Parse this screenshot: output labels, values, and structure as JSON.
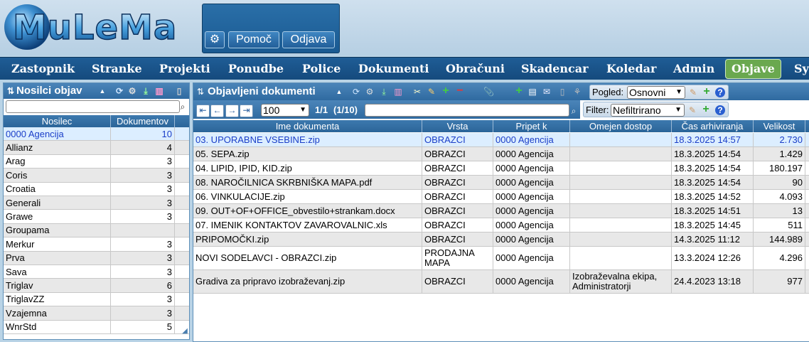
{
  "app": {
    "logo_text": "MuLeMa"
  },
  "toolbar": {
    "settings_icon": "gear-icon",
    "help_label": "Pomoč",
    "logout_label": "Odjava"
  },
  "nav": {
    "items": [
      "Zastopnik",
      "Stranke",
      "Projekti",
      "Ponudbe",
      "Police",
      "Dokumenti",
      "Obračuni",
      "Skadencar",
      "Koledar",
      "Admin",
      "Objave",
      "Sy"
    ],
    "active": "Objave"
  },
  "left_panel": {
    "title": "Nosilci objav",
    "search_placeholder": "",
    "columns": [
      "Nosilec",
      "Dokumentov"
    ],
    "rows": [
      {
        "name": "0000 Agencija",
        "count": "10"
      },
      {
        "name": "Allianz",
        "count": "4"
      },
      {
        "name": "Arag",
        "count": "3"
      },
      {
        "name": "Coris",
        "count": "3"
      },
      {
        "name": "Croatia",
        "count": "3"
      },
      {
        "name": "Generali",
        "count": "3"
      },
      {
        "name": "Grawe",
        "count": "3"
      },
      {
        "name": "Groupama",
        "count": ""
      },
      {
        "name": "Merkur",
        "count": "3"
      },
      {
        "name": "Prva",
        "count": "3"
      },
      {
        "name": "Sava",
        "count": "3"
      },
      {
        "name": "Triglav",
        "count": "6"
      },
      {
        "name": "TriglavZZ",
        "count": "3"
      },
      {
        "name": "Vzajemna",
        "count": "3"
      },
      {
        "name": "WnrStd",
        "count": "5"
      }
    ]
  },
  "main_panel": {
    "title": "Objavljeni dokumenti",
    "view_label": "Pogled:",
    "view_value": "Osnovni",
    "filter_label": "Filter:",
    "filter_value": "Nefiltrirano",
    "page_size": "100",
    "page_info": "1/1",
    "count_info": "(1/10)",
    "search_placeholder": "",
    "columns": [
      "Ime dokumenta",
      "Vrsta",
      "Pripet k",
      "Omejen dostop",
      "Čas arhiviranja",
      "Velikost"
    ],
    "rows": [
      {
        "name": "03. UPORABNE VSEBINE.zip",
        "type": "OBRAZCI",
        "attached": "0000 Agencija",
        "restricted": "",
        "time": "18.3.2025 14:57",
        "size": "2.730"
      },
      {
        "name": "05. SEPA.zip",
        "type": "OBRAZCI",
        "attached": "0000 Agencija",
        "restricted": "",
        "time": "18.3.2025 14:54",
        "size": "1.429"
      },
      {
        "name": "04. LIPID, IPID, KID.zip",
        "type": "OBRAZCI",
        "attached": "0000 Agencija",
        "restricted": "",
        "time": "18.3.2025 14:54",
        "size": "180.197"
      },
      {
        "name": "08. NAROČILNICA SKRBNIŠKA MAPA.pdf",
        "type": "OBRAZCI",
        "attached": "0000 Agencija",
        "restricted": "",
        "time": "18.3.2025 14:54",
        "size": "90"
      },
      {
        "name": "06. VINKULACIJE.zip",
        "type": "OBRAZCI",
        "attached": "0000 Agencija",
        "restricted": "",
        "time": "18.3.2025 14:52",
        "size": "4.093"
      },
      {
        "name": "09. OUT+OF+OFFICE_obvestilo+strankam.docx",
        "type": "OBRAZCI",
        "attached": "0000 Agencija",
        "restricted": "",
        "time": "18.3.2025 14:51",
        "size": "13"
      },
      {
        "name": "07. IMENIK KONTAKTOV ZAVAROVALNIC.xls",
        "type": "OBRAZCI",
        "attached": "0000 Agencija",
        "restricted": "",
        "time": "18.3.2025 14:45",
        "size": "511"
      },
      {
        "name": "PRIPOMOČKI.zip",
        "type": "OBRAZCI",
        "attached": "0000 Agencija",
        "restricted": "",
        "time": "14.3.2025 11:12",
        "size": "144.989"
      },
      {
        "name": "NOVI SODELAVCI - OBRAZCI.zip",
        "type": "PRODAJNA MAPA",
        "attached": "0000 Agencija",
        "restricted": "",
        "time": "13.3.2024 12:26",
        "size": "4.296"
      },
      {
        "name": "Gradiva za pripravo izobraževanj.zip",
        "type": "OBRAZCI",
        "attached": "0000 Agencija",
        "restricted": "Izobraževalna ekipa, Administratorji",
        "time": "24.4.2023 13:18",
        "size": "977"
      }
    ]
  },
  "colors": {
    "nav_bg": "#1f5d96",
    "active_tab": "#6aa84f",
    "selected_text": "#1a3ec8",
    "panel_header": "#3d79ae"
  }
}
